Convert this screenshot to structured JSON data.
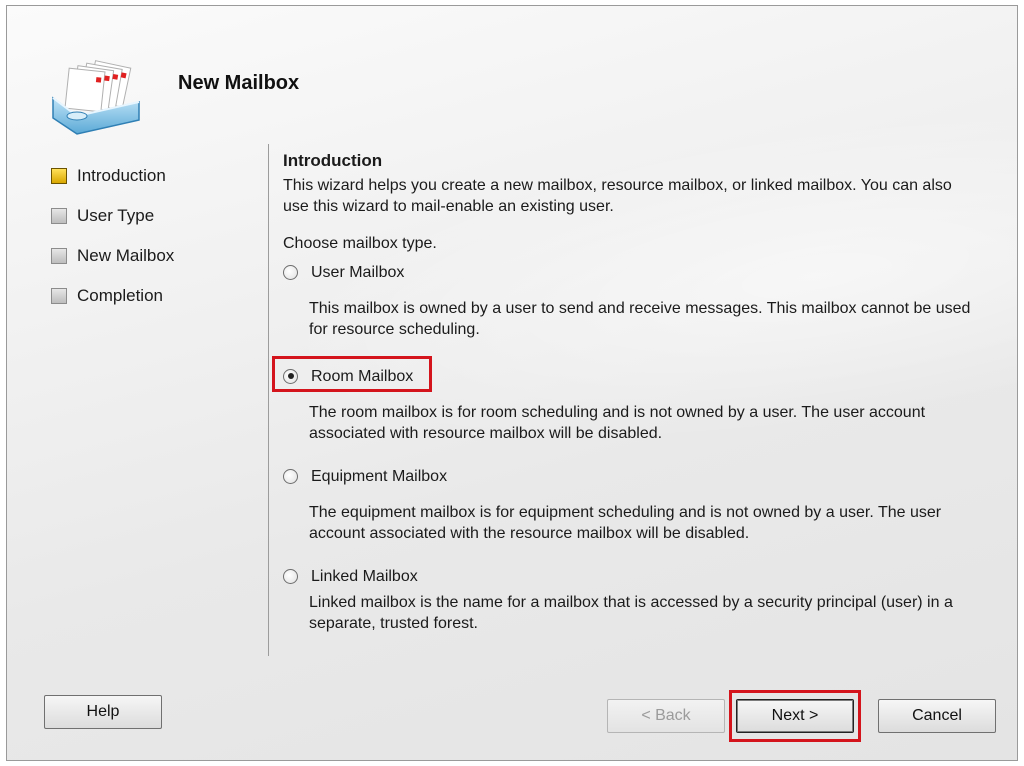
{
  "wizard": {
    "title": "New Mailbox",
    "icon": "mailbox-stack-icon"
  },
  "nav": {
    "items": [
      {
        "label": "Introduction",
        "active": true
      },
      {
        "label": "User Type",
        "active": false
      },
      {
        "label": "New Mailbox",
        "active": false
      },
      {
        "label": "Completion",
        "active": false
      }
    ]
  },
  "content": {
    "section_title": "Introduction",
    "intro_text": "This wizard helps you create a new mailbox, resource mailbox, or linked mailbox. You can also use this wizard to mail-enable an existing user.",
    "choose_label": "Choose mailbox type.",
    "selected": "Room Mailbox",
    "options": [
      {
        "label": "User Mailbox",
        "description": "This mailbox is owned by a user to send and receive messages. This mailbox cannot be used for resource scheduling."
      },
      {
        "label": "Room Mailbox",
        "description": "The room mailbox is for room scheduling and is not owned by a user. The user account associated with resource mailbox will be disabled."
      },
      {
        "label": "Equipment Mailbox",
        "description": "The equipment mailbox is for equipment scheduling and is not owned by a user. The user account associated with the resource mailbox will be disabled."
      },
      {
        "label": "Linked Mailbox",
        "description": "Linked mailbox is the name for a mailbox that is accessed by a security principal (user) in a separate, trusted forest."
      }
    ]
  },
  "buttons": {
    "help": "Help",
    "back": "< Back",
    "next": "Next >",
    "cancel": "Cancel"
  },
  "colors": {
    "highlight": "#d4141c",
    "active_step": "#e8b800"
  }
}
